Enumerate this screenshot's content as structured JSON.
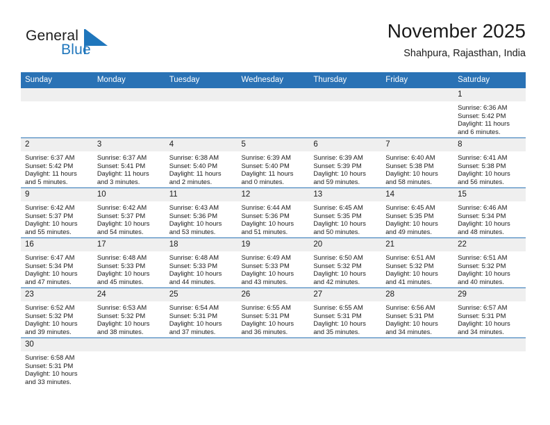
{
  "brand": {
    "name_primary": "General",
    "name_secondary": "Blue",
    "primary_color": "#1c1c1c",
    "secondary_color": "#1f76bc"
  },
  "header": {
    "title": "November 2025",
    "subtitle": "Shahpura, Rajasthan, India"
  },
  "theme": {
    "header_row_bg": "#2a72b5",
    "header_row_text": "#ffffff",
    "daynum_bg": "#efefef",
    "grid_line": "#2a72b5"
  },
  "labels": {
    "sunrise": "Sunrise:",
    "sunset": "Sunset:",
    "daylight": "Daylight:"
  },
  "weekday_headers": [
    "Sunday",
    "Monday",
    "Tuesday",
    "Wednesday",
    "Thursday",
    "Friday",
    "Saturday"
  ],
  "weeks": [
    [
      {
        "day": "",
        "sunrise": "",
        "sunset": "",
        "daylight_line1": "",
        "daylight_line2": ""
      },
      {
        "day": "",
        "sunrise": "",
        "sunset": "",
        "daylight_line1": "",
        "daylight_line2": ""
      },
      {
        "day": "",
        "sunrise": "",
        "sunset": "",
        "daylight_line1": "",
        "daylight_line2": ""
      },
      {
        "day": "",
        "sunrise": "",
        "sunset": "",
        "daylight_line1": "",
        "daylight_line2": ""
      },
      {
        "day": "",
        "sunrise": "",
        "sunset": "",
        "daylight_line1": "",
        "daylight_line2": ""
      },
      {
        "day": "",
        "sunrise": "",
        "sunset": "",
        "daylight_line1": "",
        "daylight_line2": ""
      },
      {
        "day": "1",
        "sunrise": "Sunrise: 6:36 AM",
        "sunset": "Sunset: 5:42 PM",
        "daylight_line1": "Daylight: 11 hours",
        "daylight_line2": "and 6 minutes."
      }
    ],
    [
      {
        "day": "2",
        "sunrise": "Sunrise: 6:37 AM",
        "sunset": "Sunset: 5:42 PM",
        "daylight_line1": "Daylight: 11 hours",
        "daylight_line2": "and 5 minutes."
      },
      {
        "day": "3",
        "sunrise": "Sunrise: 6:37 AM",
        "sunset": "Sunset: 5:41 PM",
        "daylight_line1": "Daylight: 11 hours",
        "daylight_line2": "and 3 minutes."
      },
      {
        "day": "4",
        "sunrise": "Sunrise: 6:38 AM",
        "sunset": "Sunset: 5:40 PM",
        "daylight_line1": "Daylight: 11 hours",
        "daylight_line2": "and 2 minutes."
      },
      {
        "day": "5",
        "sunrise": "Sunrise: 6:39 AM",
        "sunset": "Sunset: 5:40 PM",
        "daylight_line1": "Daylight: 11 hours",
        "daylight_line2": "and 0 minutes."
      },
      {
        "day": "6",
        "sunrise": "Sunrise: 6:39 AM",
        "sunset": "Sunset: 5:39 PM",
        "daylight_line1": "Daylight: 10 hours",
        "daylight_line2": "and 59 minutes."
      },
      {
        "day": "7",
        "sunrise": "Sunrise: 6:40 AM",
        "sunset": "Sunset: 5:38 PM",
        "daylight_line1": "Daylight: 10 hours",
        "daylight_line2": "and 58 minutes."
      },
      {
        "day": "8",
        "sunrise": "Sunrise: 6:41 AM",
        "sunset": "Sunset: 5:38 PM",
        "daylight_line1": "Daylight: 10 hours",
        "daylight_line2": "and 56 minutes."
      }
    ],
    [
      {
        "day": "9",
        "sunrise": "Sunrise: 6:42 AM",
        "sunset": "Sunset: 5:37 PM",
        "daylight_line1": "Daylight: 10 hours",
        "daylight_line2": "and 55 minutes."
      },
      {
        "day": "10",
        "sunrise": "Sunrise: 6:42 AM",
        "sunset": "Sunset: 5:37 PM",
        "daylight_line1": "Daylight: 10 hours",
        "daylight_line2": "and 54 minutes."
      },
      {
        "day": "11",
        "sunrise": "Sunrise: 6:43 AM",
        "sunset": "Sunset: 5:36 PM",
        "daylight_line1": "Daylight: 10 hours",
        "daylight_line2": "and 53 minutes."
      },
      {
        "day": "12",
        "sunrise": "Sunrise: 6:44 AM",
        "sunset": "Sunset: 5:36 PM",
        "daylight_line1": "Daylight: 10 hours",
        "daylight_line2": "and 51 minutes."
      },
      {
        "day": "13",
        "sunrise": "Sunrise: 6:45 AM",
        "sunset": "Sunset: 5:35 PM",
        "daylight_line1": "Daylight: 10 hours",
        "daylight_line2": "and 50 minutes."
      },
      {
        "day": "14",
        "sunrise": "Sunrise: 6:45 AM",
        "sunset": "Sunset: 5:35 PM",
        "daylight_line1": "Daylight: 10 hours",
        "daylight_line2": "and 49 minutes."
      },
      {
        "day": "15",
        "sunrise": "Sunrise: 6:46 AM",
        "sunset": "Sunset: 5:34 PM",
        "daylight_line1": "Daylight: 10 hours",
        "daylight_line2": "and 48 minutes."
      }
    ],
    [
      {
        "day": "16",
        "sunrise": "Sunrise: 6:47 AM",
        "sunset": "Sunset: 5:34 PM",
        "daylight_line1": "Daylight: 10 hours",
        "daylight_line2": "and 47 minutes."
      },
      {
        "day": "17",
        "sunrise": "Sunrise: 6:48 AM",
        "sunset": "Sunset: 5:33 PM",
        "daylight_line1": "Daylight: 10 hours",
        "daylight_line2": "and 45 minutes."
      },
      {
        "day": "18",
        "sunrise": "Sunrise: 6:48 AM",
        "sunset": "Sunset: 5:33 PM",
        "daylight_line1": "Daylight: 10 hours",
        "daylight_line2": "and 44 minutes."
      },
      {
        "day": "19",
        "sunrise": "Sunrise: 6:49 AM",
        "sunset": "Sunset: 5:33 PM",
        "daylight_line1": "Daylight: 10 hours",
        "daylight_line2": "and 43 minutes."
      },
      {
        "day": "20",
        "sunrise": "Sunrise: 6:50 AM",
        "sunset": "Sunset: 5:32 PM",
        "daylight_line1": "Daylight: 10 hours",
        "daylight_line2": "and 42 minutes."
      },
      {
        "day": "21",
        "sunrise": "Sunrise: 6:51 AM",
        "sunset": "Sunset: 5:32 PM",
        "daylight_line1": "Daylight: 10 hours",
        "daylight_line2": "and 41 minutes."
      },
      {
        "day": "22",
        "sunrise": "Sunrise: 6:51 AM",
        "sunset": "Sunset: 5:32 PM",
        "daylight_line1": "Daylight: 10 hours",
        "daylight_line2": "and 40 minutes."
      }
    ],
    [
      {
        "day": "23",
        "sunrise": "Sunrise: 6:52 AM",
        "sunset": "Sunset: 5:32 PM",
        "daylight_line1": "Daylight: 10 hours",
        "daylight_line2": "and 39 minutes."
      },
      {
        "day": "24",
        "sunrise": "Sunrise: 6:53 AM",
        "sunset": "Sunset: 5:32 PM",
        "daylight_line1": "Daylight: 10 hours",
        "daylight_line2": "and 38 minutes."
      },
      {
        "day": "25",
        "sunrise": "Sunrise: 6:54 AM",
        "sunset": "Sunset: 5:31 PM",
        "daylight_line1": "Daylight: 10 hours",
        "daylight_line2": "and 37 minutes."
      },
      {
        "day": "26",
        "sunrise": "Sunrise: 6:55 AM",
        "sunset": "Sunset: 5:31 PM",
        "daylight_line1": "Daylight: 10 hours",
        "daylight_line2": "and 36 minutes."
      },
      {
        "day": "27",
        "sunrise": "Sunrise: 6:55 AM",
        "sunset": "Sunset: 5:31 PM",
        "daylight_line1": "Daylight: 10 hours",
        "daylight_line2": "and 35 minutes."
      },
      {
        "day": "28",
        "sunrise": "Sunrise: 6:56 AM",
        "sunset": "Sunset: 5:31 PM",
        "daylight_line1": "Daylight: 10 hours",
        "daylight_line2": "and 34 minutes."
      },
      {
        "day": "29",
        "sunrise": "Sunrise: 6:57 AM",
        "sunset": "Sunset: 5:31 PM",
        "daylight_line1": "Daylight: 10 hours",
        "daylight_line2": "and 34 minutes."
      }
    ],
    [
      {
        "day": "30",
        "sunrise": "Sunrise: 6:58 AM",
        "sunset": "Sunset: 5:31 PM",
        "daylight_line1": "Daylight: 10 hours",
        "daylight_line2": "and 33 minutes."
      },
      {
        "day": "",
        "sunrise": "",
        "sunset": "",
        "daylight_line1": "",
        "daylight_line2": ""
      },
      {
        "day": "",
        "sunrise": "",
        "sunset": "",
        "daylight_line1": "",
        "daylight_line2": ""
      },
      {
        "day": "",
        "sunrise": "",
        "sunset": "",
        "daylight_line1": "",
        "daylight_line2": ""
      },
      {
        "day": "",
        "sunrise": "",
        "sunset": "",
        "daylight_line1": "",
        "daylight_line2": ""
      },
      {
        "day": "",
        "sunrise": "",
        "sunset": "",
        "daylight_line1": "",
        "daylight_line2": ""
      },
      {
        "day": "",
        "sunrise": "",
        "sunset": "",
        "daylight_line1": "",
        "daylight_line2": ""
      }
    ]
  ]
}
